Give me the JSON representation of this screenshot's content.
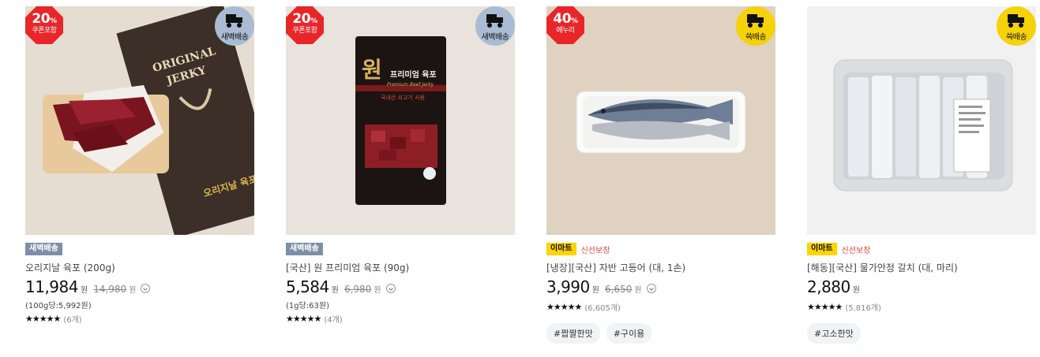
{
  "products": [
    {
      "discount": {
        "pct": "20",
        "pct_unit": "%",
        "sub": "쿠폰포함"
      },
      "delivery": "새벽배송",
      "badge_dawn": "새벽배송",
      "title": "오리지날 육포 (200g)",
      "price": "11,984",
      "won": "원",
      "orig_price": "14,980",
      "orig_won": "원",
      "unit_price": "(100g당:5,992원)",
      "stars": "★★★★★",
      "rating_value": 4.5,
      "review_count": "(6개)",
      "package_text": [
        "ORIGINAL",
        "JERKY",
        "오리지날 육포"
      ]
    },
    {
      "discount": {
        "pct": "20",
        "pct_unit": "%",
        "sub": "쿠폰포함"
      },
      "delivery": "새벽배송",
      "badge_dawn": "새벽배송",
      "title": "[국산] 원 프리미엄 육포 (90g)",
      "price": "5,584",
      "won": "원",
      "orig_price": "6,980",
      "orig_won": "원",
      "unit_price": "(1g당:63원)",
      "stars": "★★★★★",
      "rating_value": 5,
      "review_count": "(4개)",
      "package_text": [
        "원",
        "프리미엄 육포",
        "Premium Beef Jerky",
        "국내산 쇠고기 사용"
      ]
    },
    {
      "discount": {
        "pct": "40",
        "pct_unit": "%",
        "sub": "에누리"
      },
      "delivery": "쓱배송",
      "badge_emart": "이마트",
      "badge_fresh": "신선보장",
      "title": "[냉장][국산] 자반 고등어 (대, 1손)",
      "price": "3,990",
      "won": "원",
      "orig_price": "6,650",
      "orig_won": "원",
      "stars": "★★★★★",
      "rating_value": 5,
      "review_count": "(6,605개)",
      "hashtags": [
        "#짭짤한맛",
        "#구이용"
      ]
    },
    {
      "delivery": "쓱배송",
      "badge_emart": "이마트",
      "badge_fresh": "신선보장",
      "title": "[해동][국산] 물가안정 갈치 (대, 마리)",
      "price": "2,880",
      "won": "원",
      "stars": "★★★★★",
      "rating_value": 4.5,
      "review_count": "(5,816개)",
      "hashtags": [
        "#고소한맛"
      ]
    }
  ],
  "colors": {
    "discount_red": "#e8262a",
    "dawn_blue": "#a9bcd3",
    "ssg_yellow": "#f5d20a",
    "fresh_red": "#e6403a"
  }
}
